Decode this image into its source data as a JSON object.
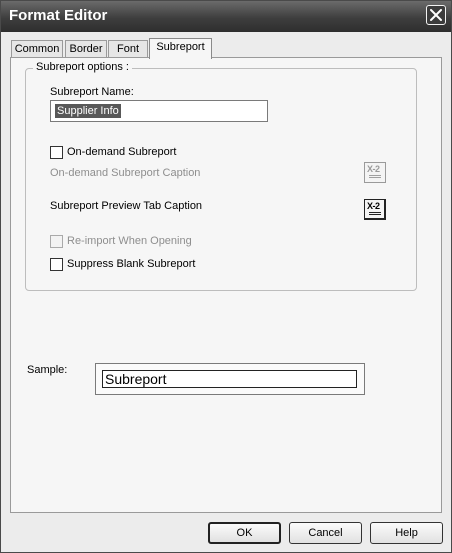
{
  "window": {
    "title": "Format Editor",
    "close_icon": "close-icon"
  },
  "tabs": [
    {
      "label": "Common",
      "active": false
    },
    {
      "label": "Border",
      "active": false
    },
    {
      "label": "Font",
      "active": false
    },
    {
      "label": "Subreport",
      "active": true
    }
  ],
  "subreport_options": {
    "group_label": "Subreport options :",
    "name_label": "Subreport Name:",
    "name_value": "Supplier Info",
    "on_demand_label": "On-demand Subreport",
    "on_demand_checked": false,
    "on_demand_caption_label": "On-demand Subreport Caption",
    "preview_caption_label": "Subreport Preview Tab Caption",
    "reimport_label": "Re-import When Opening",
    "reimport_checked": false,
    "suppress_label": "Suppress Blank Subreport",
    "suppress_checked": false,
    "formula_button_glyph": "X-2"
  },
  "sample": {
    "label": "Sample:",
    "text": "Subreport"
  },
  "buttons": {
    "ok": "OK",
    "cancel": "Cancel",
    "help": "Help"
  }
}
